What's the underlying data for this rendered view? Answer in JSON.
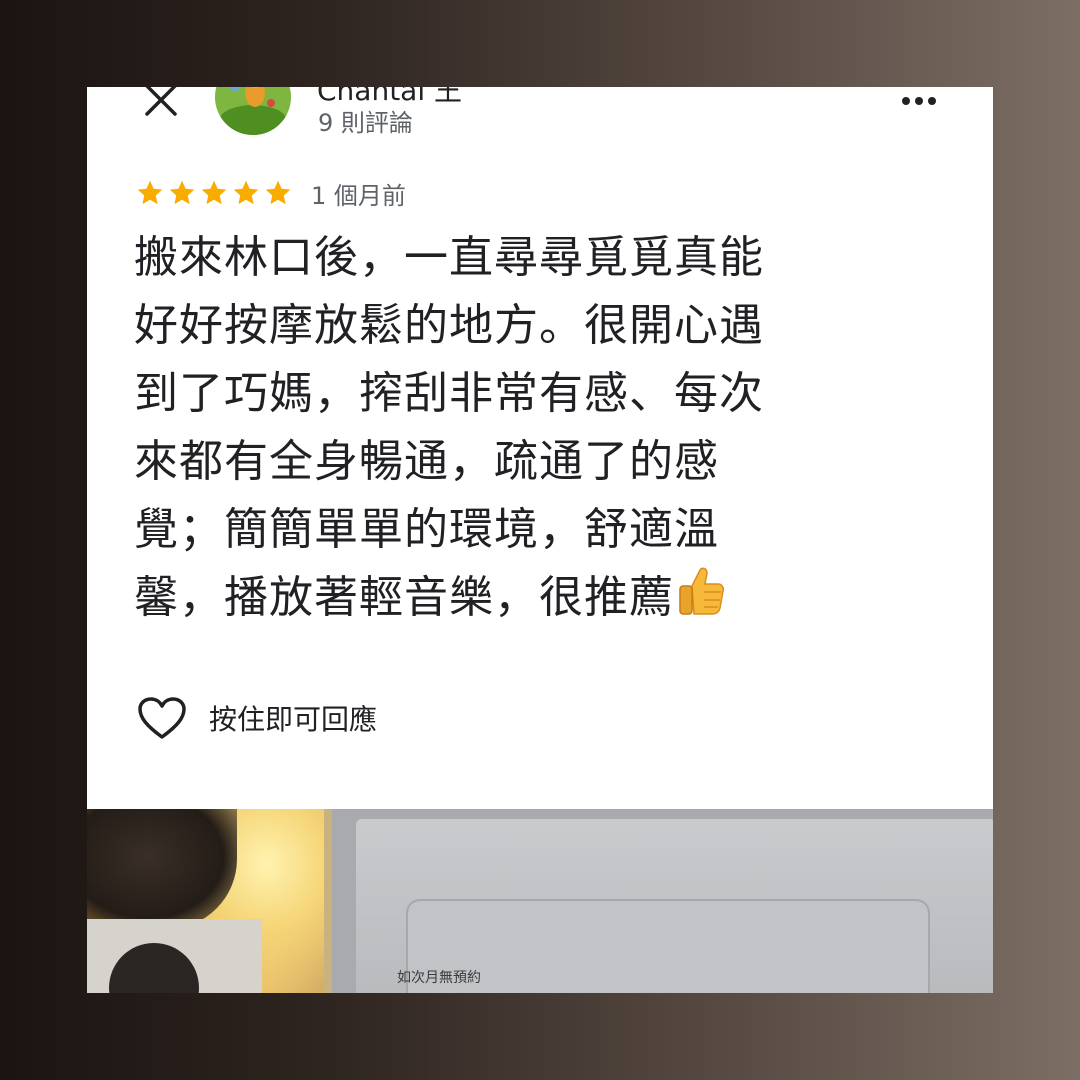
{
  "reviewer": {
    "name": "Chantal 王",
    "review_count": "9 則評論"
  },
  "rating": {
    "stars": 5,
    "max": 5,
    "time_ago": "1 個月前",
    "star_color": "#f9ab00"
  },
  "review": {
    "lines": [
      "搬來林口後，一直尋尋覓覓真能",
      "好好按摩放鬆的地方。很開心遇",
      "到了巧媽，搾刮非常有感、每次",
      "來都有全身暢通，疏通了的感",
      "覺；簡簡單單的環境，舒適溫",
      "馨，播放著輕音樂，很推薦"
    ],
    "emoji_icon": "thumbs-up-icon"
  },
  "actions": {
    "react_label": "按住即可回應"
  },
  "photo": {
    "sign_text": "如次月無預約"
  }
}
